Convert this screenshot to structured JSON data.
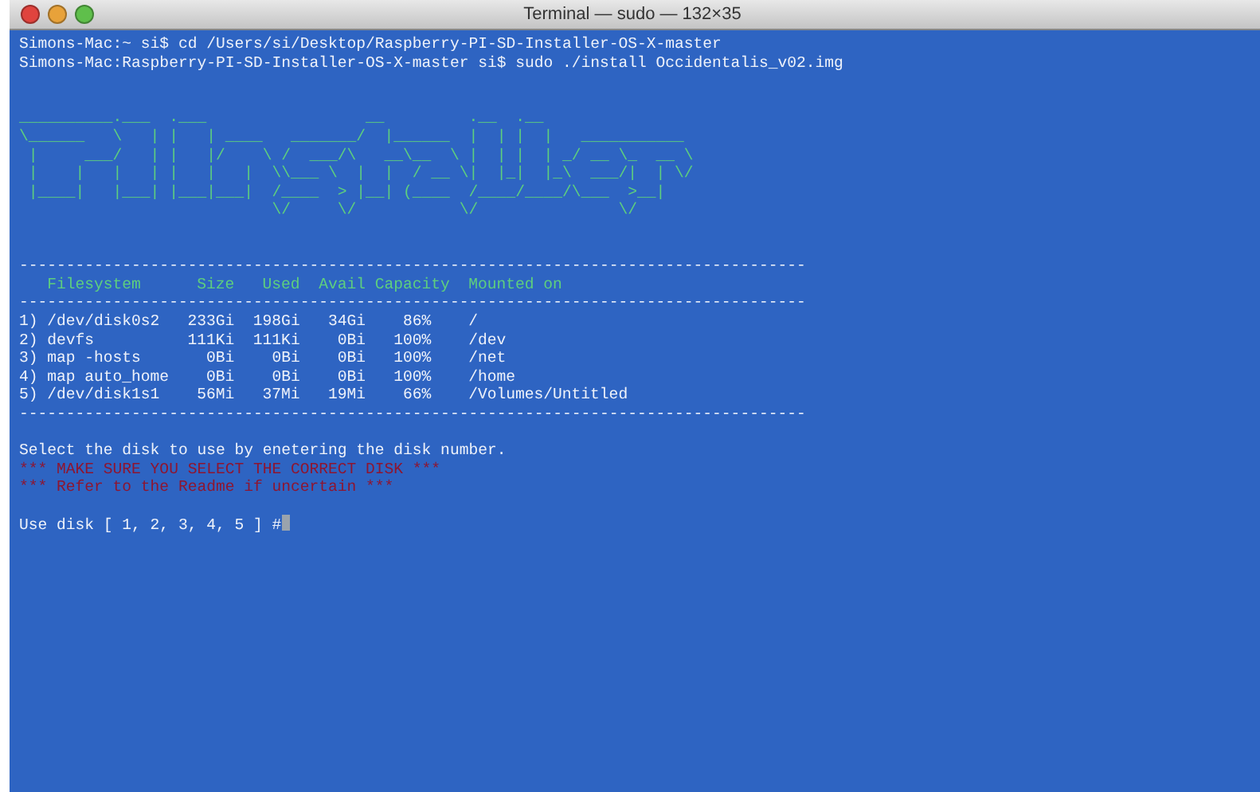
{
  "window": {
    "title": "Terminal — sudo — 132×35"
  },
  "commands": [
    "Simons-Mac:~ si$ cd /Users/si/Desktop/Raspberry-PI-SD-Installer-OS-X-master",
    "Simons-Mac:Raspberry-PI-SD-Installer-OS-X-master si$ sudo ./install Occidentalis_v02.img"
  ],
  "banner": [
    "__________.___  .___                 __         .__  .__",
    "\\______   \\   | |   | ____   _______/  |______  |  | |  |   ___________",
    " |     ___/   | |   |/    \\ /  ___/\\   __\\__  \\ |  | |  | _/ __ \\_  __ \\",
    " |    |   |   | |   |   |  \\\\___ \\  |  |  / __ \\|  |_|  |_\\  ___/|  | \\/",
    " |____|   |___| |___|___|  /____  > |__| (____  /____/____/\\___  >__|",
    "                           \\/     \\/           \\/               \\/"
  ],
  "rule": "------------------------------------------------------------------------------------",
  "table": {
    "columns": [
      "Filesystem",
      "Size",
      "Used",
      "Avail",
      "Capacity",
      "Mounted on"
    ],
    "rows": [
      {
        "index": "1)",
        "cells": [
          "/dev/disk0s2",
          "233Gi",
          "198Gi",
          "34Gi",
          "86%",
          "/"
        ]
      },
      {
        "index": "2)",
        "cells": [
          "devfs",
          "111Ki",
          "111Ki",
          "0Bi",
          "100%",
          "/dev"
        ]
      },
      {
        "index": "3)",
        "cells": [
          "map -hosts",
          "0Bi",
          "0Bi",
          "0Bi",
          "100%",
          "/net"
        ]
      },
      {
        "index": "4)",
        "cells": [
          "map auto_home",
          "0Bi",
          "0Bi",
          "0Bi",
          "100%",
          "/home"
        ]
      },
      {
        "index": "5)",
        "cells": [
          "/dev/disk1s1",
          "56Mi",
          "37Mi",
          "19Mi",
          "66%",
          "/Volumes/Untitled"
        ]
      }
    ]
  },
  "messages": [
    {
      "kind": "info",
      "text": "Select the disk to use by enetering the disk number."
    },
    {
      "kind": "warning",
      "text": "*** MAKE SURE YOU SELECT THE CORRECT DISK ***"
    },
    {
      "kind": "warning",
      "text": "*** Refer to the Readme if uncertain ***"
    }
  ],
  "prompt": "Use disk [ 1, 2, 3, 4, 5 ] #"
}
